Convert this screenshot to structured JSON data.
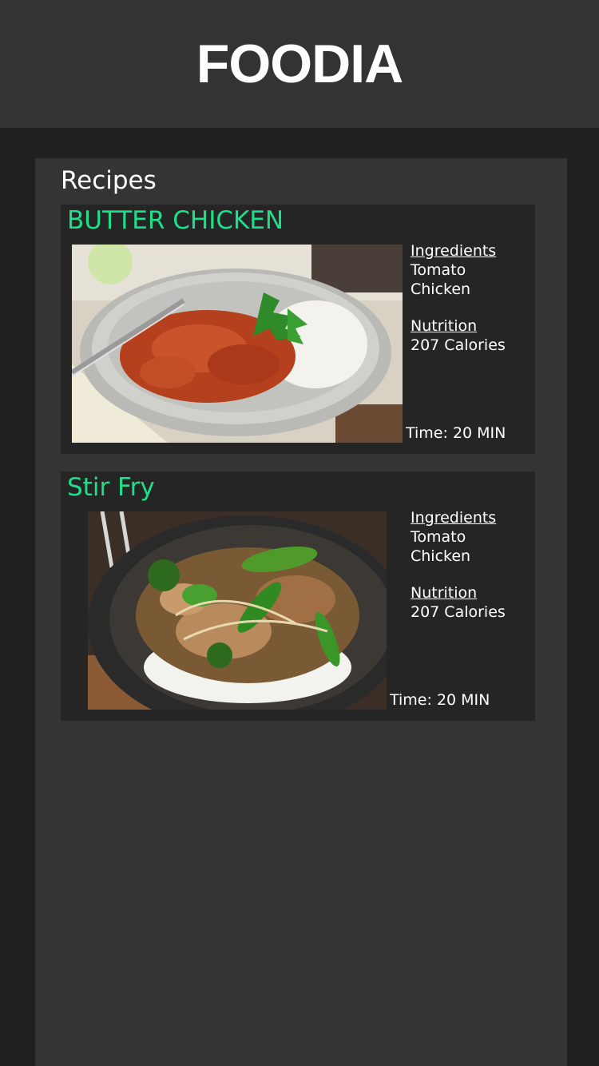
{
  "header": {
    "title": "FOODIA"
  },
  "main": {
    "section_title": "Recipes",
    "recipes": [
      {
        "name": "BUTTER CHICKEN",
        "image_alt": "butter chicken with rice in a bowl",
        "ingredients_label": "Ingredients",
        "ingredients": [
          "Tomato",
          "Chicken"
        ],
        "nutrition_label": "Nutrition",
        "nutrition": "207 Calories",
        "time": "Time: 20 MIN"
      },
      {
        "name": "Stir Fry",
        "image_alt": "chicken stir fry with vegetables over rice",
        "ingredients_label": "Ingredients",
        "ingredients": [
          "Tomato",
          "Chicken"
        ],
        "nutrition_label": "Nutrition",
        "nutrition": "207 Calories",
        "time": "Time: 20 MIN"
      }
    ]
  },
  "colors": {
    "header_bg": "#333333",
    "page_bg": "#202020",
    "panel_bg": "#343434",
    "card_bg": "#252525",
    "accent": "#1de08a"
  }
}
